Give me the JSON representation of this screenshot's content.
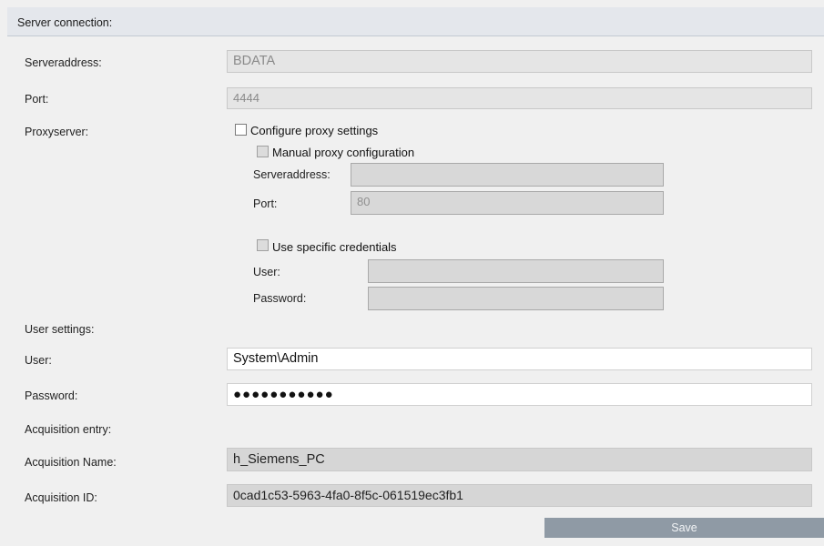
{
  "server": {
    "section_title": "Server connection:",
    "address_label": "Serveraddress:",
    "address_value": "BDATA",
    "port_label": "Port:",
    "port_value": "4444",
    "proxy_label": "Proxyserver:"
  },
  "proxy": {
    "configure_label": "Configure proxy settings",
    "configure_checked": false,
    "manual_label": "Manual proxy configuration",
    "manual_checked": false,
    "address_label": "Serveraddress:",
    "address_value": "",
    "port_label": "Port:",
    "port_value": "80",
    "credentials_label": "Use specific credentials",
    "credentials_checked": false,
    "user_label": "User:",
    "user_value": "",
    "password_label": "Password:",
    "password_value": ""
  },
  "user_settings": {
    "section_title": "User settings:",
    "user_label": "User:",
    "user_value": "System\\Admin",
    "password_label": "Password:",
    "password_value": "●●●●●●●●●●●"
  },
  "acquisition": {
    "section_title": "Acquisition entry:",
    "name_label": "Acquisition Name:",
    "name_value": "h_Siemens_PC",
    "id_label": "Acquisition ID:",
    "id_value": "0cad1c53-5963-4fa0-8f5c-061519ec3fb1"
  },
  "actions": {
    "save_label": "Save"
  }
}
